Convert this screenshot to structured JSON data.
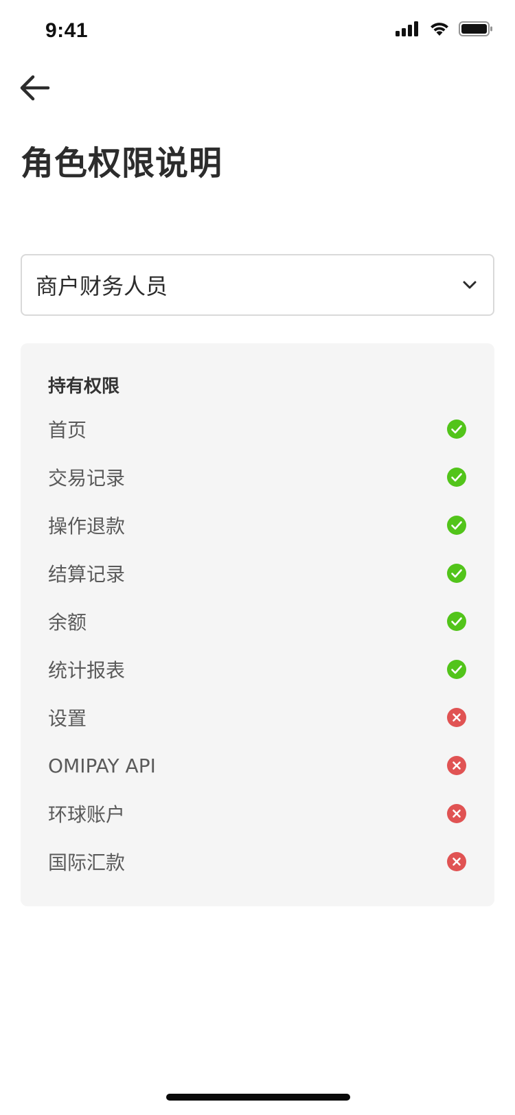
{
  "status_bar": {
    "time": "9:41",
    "icons": [
      "signal-icon",
      "wifi-icon",
      "battery-icon"
    ]
  },
  "header": {
    "back_icon": "arrow-left-icon",
    "title": "角色权限说明"
  },
  "role_select": {
    "value": "商户财务人员",
    "icon": "chevron-down-icon"
  },
  "permissions": {
    "heading": "持有权限",
    "items": [
      {
        "label": "首页",
        "granted": true
      },
      {
        "label": "交易记录",
        "granted": true
      },
      {
        "label": "操作退款",
        "granted": true
      },
      {
        "label": "结算记录",
        "granted": true
      },
      {
        "label": "余额",
        "granted": true
      },
      {
        "label": "统计报表",
        "granted": true
      },
      {
        "label": "设置",
        "granted": false
      },
      {
        "label": "OMIPAY API",
        "granted": false
      },
      {
        "label": "环球账户",
        "granted": false
      },
      {
        "label": "国际汇款",
        "granted": false
      }
    ],
    "colors": {
      "granted": "#52c41a",
      "denied": "#e05353"
    },
    "icons": {
      "granted": "check-circle-icon",
      "denied": "close-circle-icon"
    }
  }
}
